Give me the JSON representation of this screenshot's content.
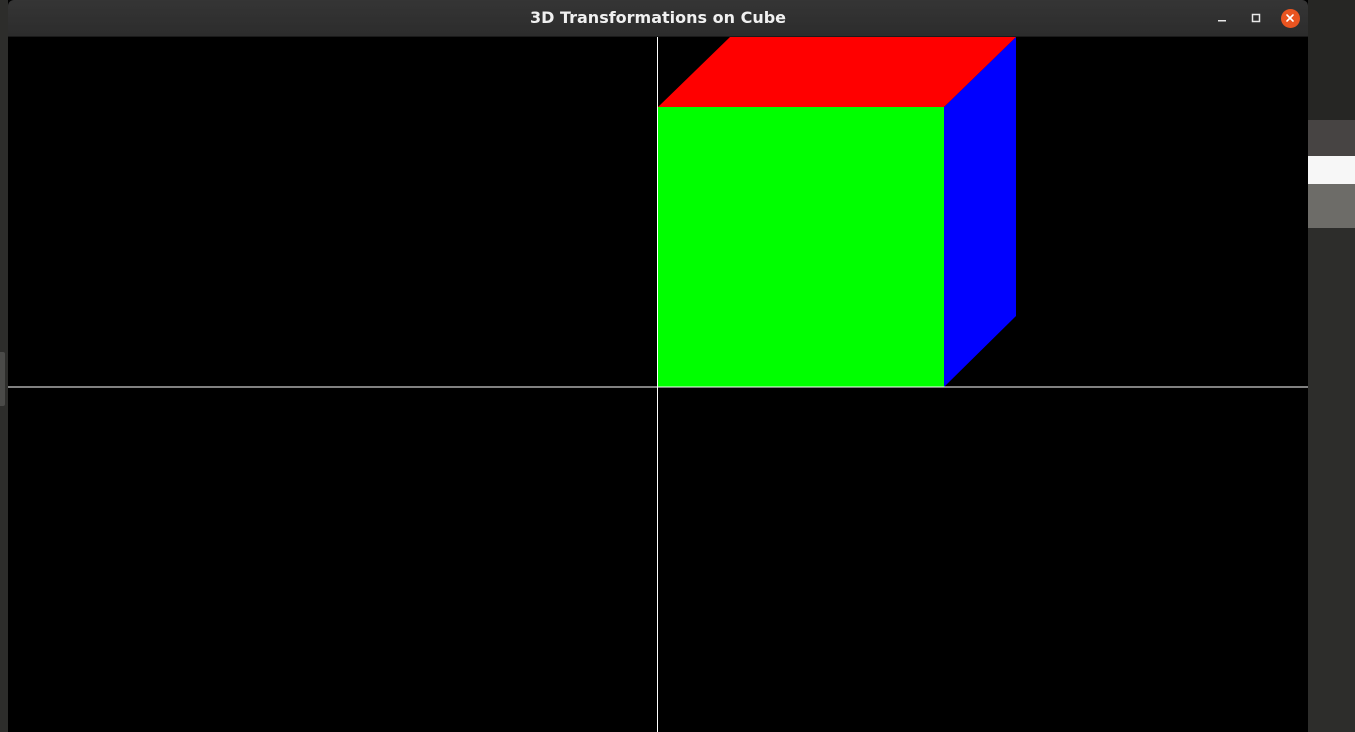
{
  "window": {
    "title": "3D Transformations on Cube"
  },
  "icons": {
    "minimize": "minimize-icon",
    "maximize": "maximize-icon",
    "close": "close-icon"
  },
  "colors": {
    "canvas_background": "#000000",
    "axis_lines": "#ffffff",
    "cube_front_face": "#00ff00",
    "cube_top_face": "#ff0000",
    "cube_right_face": "#0000ff",
    "close_button": "#e95420",
    "titlebar": "#303030"
  }
}
